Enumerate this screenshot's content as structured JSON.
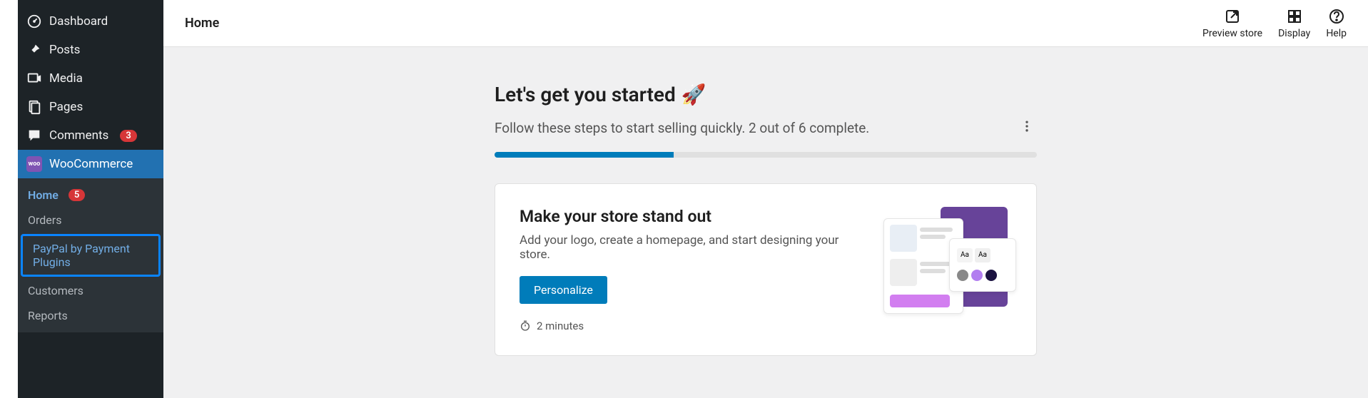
{
  "sidebar": {
    "dashboard": "Dashboard",
    "posts": "Posts",
    "media": "Media",
    "pages": "Pages",
    "comments": "Comments",
    "comments_count": "3",
    "woocommerce": "WooCommerce",
    "submenu": {
      "home": "Home",
      "home_count": "5",
      "orders": "Orders",
      "paypal": "PayPal by Payment Plugins",
      "customers": "Customers",
      "reports": "Reports"
    }
  },
  "topbar": {
    "title": "Home",
    "preview": "Preview store",
    "display": "Display",
    "help": "Help"
  },
  "content": {
    "heading": "Let's get you started",
    "rocket": "🚀",
    "subheading": "Follow these steps to start selling quickly. 2 out of 6 complete.",
    "progress_percent": 33,
    "card": {
      "title": "Make your store stand out",
      "desc": "Add your logo, create a homepage, and start designing your store.",
      "button": "Personalize",
      "time": "2 minutes"
    }
  }
}
